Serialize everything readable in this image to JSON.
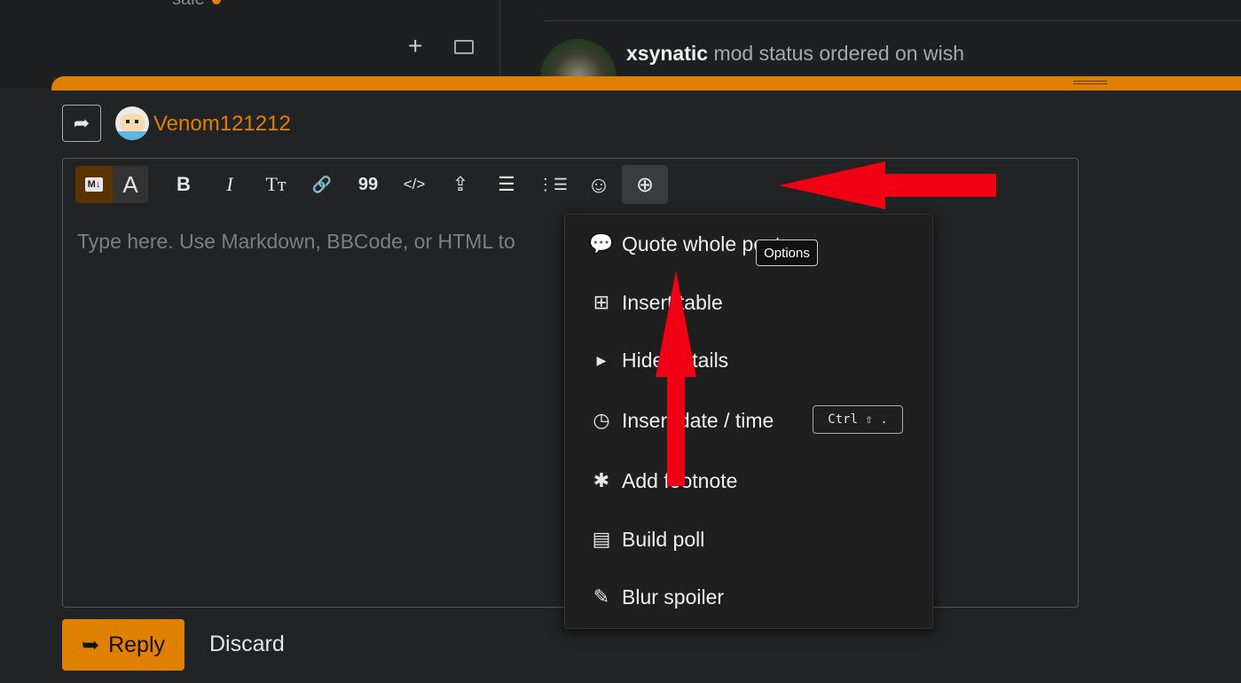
{
  "background": {
    "sale_text": "sale",
    "post_author": "xsynatic",
    "post_text": "mod status ordered on wish"
  },
  "editor": {
    "username": "Venom121212",
    "placeholder": "Type here. Use Markdown, BBCode, or HTML to",
    "toolbar": {
      "markdown_mode": "M↓",
      "rich_text_mode": "A",
      "bold": "B",
      "italic": "I",
      "heading": "Tт",
      "link": "🔗",
      "quote": "99",
      "code": "</>",
      "upload": "⇪",
      "bullet_list": "☰",
      "numbered_list": "⋮☰",
      "emoji": "☺",
      "options": "⊕"
    },
    "options_tooltip": "Options",
    "options_menu": [
      {
        "icon": "speech-bubble-icon",
        "glyph": "💬",
        "label": "Quote whole post"
      },
      {
        "icon": "table-icon",
        "glyph": "⊞",
        "label": "Insert table"
      },
      {
        "icon": "caret-right-icon",
        "glyph": "▶",
        "label": "Hide details"
      },
      {
        "icon": "clock-icon",
        "glyph": "◷",
        "label": "Insert date / time",
        "shortcut": "Ctrl ⇧ ."
      },
      {
        "icon": "asterisk-icon",
        "glyph": "✱",
        "label": "Add footnote"
      },
      {
        "icon": "poll-icon",
        "glyph": "▤",
        "label": "Build poll"
      },
      {
        "icon": "pencil-icon",
        "glyph": "✎",
        "label": "Blur spoiler"
      }
    ],
    "reply_button": "Reply",
    "discard_button": "Discard"
  },
  "colors": {
    "accent": "#e08000",
    "annotation_arrow": "#f00014"
  }
}
